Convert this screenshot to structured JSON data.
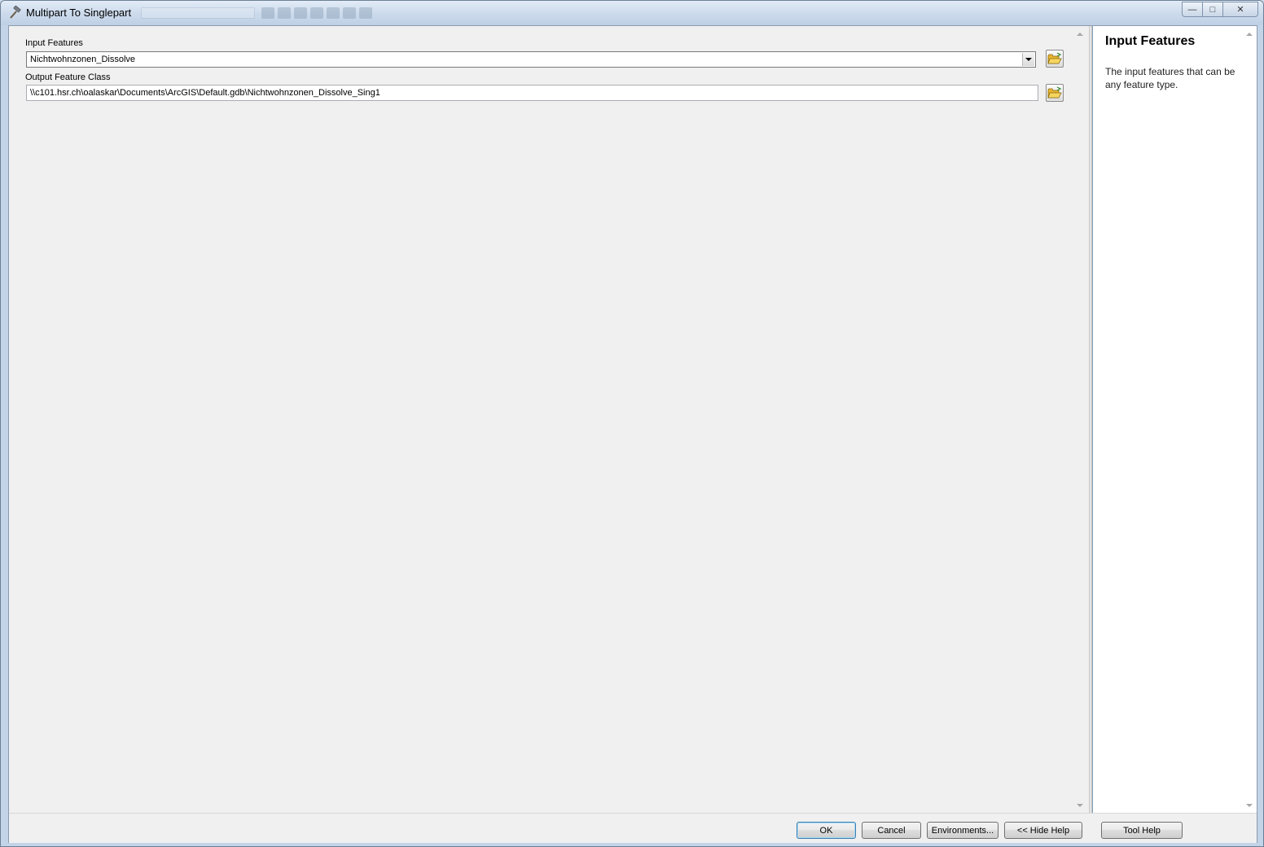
{
  "window": {
    "title": "Multipart To Singlepart",
    "minimize_glyph": "—",
    "maximize_glyph": "□",
    "close_glyph": "✕"
  },
  "params": {
    "input_features": {
      "label": "Input Features",
      "value": "Nichtwohnzonen_Dissolve"
    },
    "output_feature_class": {
      "label": "Output Feature Class",
      "value": "\\\\c101.hsr.ch\\oalaskar\\Documents\\ArcGIS\\Default.gdb\\Nichtwohnzonen_Dissolve_Sing1"
    }
  },
  "help": {
    "title": "Input Features",
    "body": "The input features that can be any feature type."
  },
  "buttons": {
    "ok": "OK",
    "cancel": "Cancel",
    "environments": "Environments...",
    "hide_help": "<< Hide Help",
    "tool_help": "Tool Help"
  },
  "icons": {
    "app": "hammer-icon",
    "browse": "open-folder-icon"
  },
  "colors": {
    "titlebar": "#cddbec",
    "panel_bg": "#f0f0f0",
    "help_bg": "#ffffff",
    "folder_yellow": "#f2c43a"
  }
}
